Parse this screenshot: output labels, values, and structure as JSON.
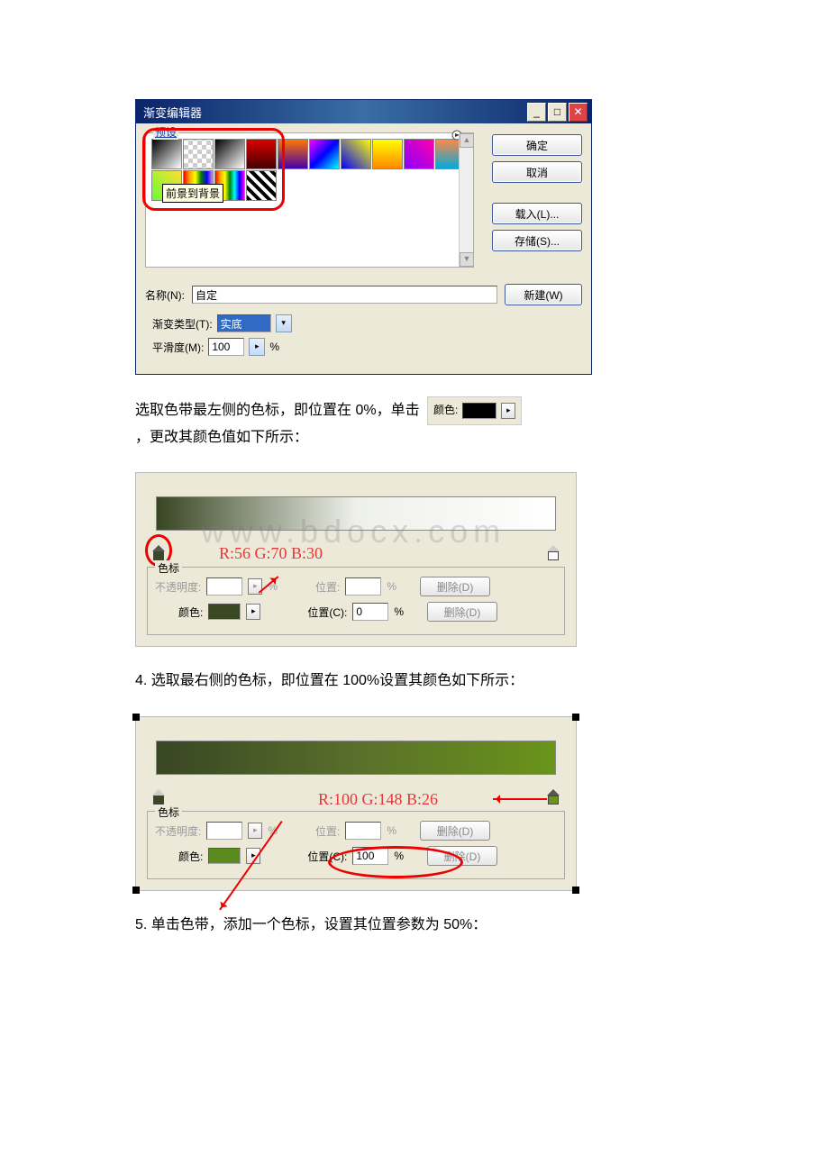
{
  "dialog": {
    "title": "渐变编辑器",
    "presets_label": "预设",
    "tooltip": "前景到背景",
    "buttons": {
      "ok": "确定",
      "cancel": "取消",
      "load": "载入(L)...",
      "save": "存储(S)..."
    },
    "name_label": "名称(N):",
    "name_value": "自定",
    "new_btn": "新建(W)",
    "gradient_type_label": "渐变类型(T):",
    "gradient_type_value": "实底",
    "smoothness_label": "平滑度(M):",
    "smoothness_value": "100",
    "percent": "%"
  },
  "para1_before": "选取色带最左侧的色标，即位置在 0%，单击",
  "inline_color_label": "颜色:",
  "para1_after": "，更改其颜色值如下所示：",
  "panel_a": {
    "annot": "R:56 G:70 B:30",
    "watermark": "www.bdocx.com",
    "stops_legend": "色标",
    "opacity_label": "不透明度:",
    "position_label": "位置:",
    "percent": "%",
    "delete_label": "删除(D)",
    "color_label": "颜色:",
    "position_c_label": "位置(C):",
    "position_c_value": "0",
    "stop_color": "#394722"
  },
  "para2": "4. 选取最右侧的色标，即位置在 100%设置其颜色如下所示：",
  "panel_b": {
    "annot": "R:100 G:148 B:26",
    "stops_legend": "色标",
    "opacity_label": "不透明度:",
    "position_label": "位置:",
    "percent": "%",
    "delete_label": "删除(D)",
    "color_label": "颜色:",
    "position_c_label": "位置(C):",
    "position_c_value": "100",
    "stop_color": "#5a8a1c"
  },
  "para3": "5. 单击色带，添加一个色标，设置其位置参数为 50%："
}
